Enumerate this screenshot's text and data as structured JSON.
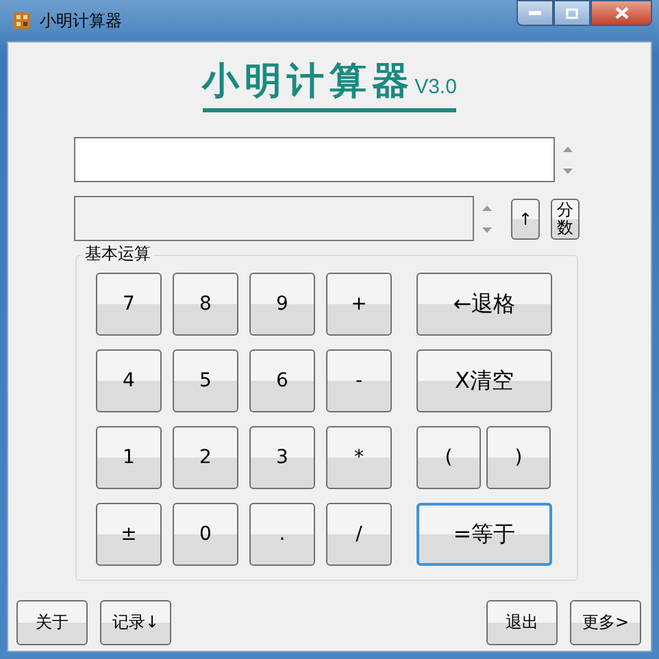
{
  "window": {
    "title": "小明计算器"
  },
  "heading": {
    "title": "小明计算器",
    "version": "V3.0"
  },
  "side_buttons": [
    {
      "label": "↑",
      "kind": "arrow"
    },
    {
      "label": "分数",
      "kind": "vertical"
    }
  ],
  "group": {
    "title": "基本运算",
    "rows": [
      [
        {
          "label": "7",
          "kind": "normal",
          "focused": false
        },
        {
          "label": "8",
          "kind": "normal",
          "focused": false
        },
        {
          "label": "9",
          "kind": "normal",
          "focused": false
        },
        {
          "label": "+",
          "kind": "normal",
          "focused": false
        },
        {
          "label": "←退格",
          "kind": "wide",
          "focused": false
        }
      ],
      [
        {
          "label": "4",
          "kind": "normal",
          "focused": false
        },
        {
          "label": "5",
          "kind": "normal",
          "focused": false
        },
        {
          "label": "6",
          "kind": "normal",
          "focused": false
        },
        {
          "label": "-",
          "kind": "normal",
          "focused": false
        },
        {
          "label": "X清空",
          "kind": "wide",
          "focused": false
        }
      ],
      [
        {
          "label": "1",
          "kind": "normal",
          "focused": false
        },
        {
          "label": "2",
          "kind": "normal",
          "focused": false
        },
        {
          "label": "3",
          "kind": "normal",
          "focused": false
        },
        {
          "label": "*",
          "kind": "normal",
          "focused": false
        },
        {
          "label": "(",
          "kind": "half",
          "focused": false
        },
        {
          "label": ")",
          "kind": "half",
          "focused": false
        }
      ],
      [
        {
          "label": "±",
          "kind": "normal",
          "focused": false
        },
        {
          "label": "0",
          "kind": "normal",
          "focused": false
        },
        {
          "label": ".",
          "kind": "normal",
          "focused": false
        },
        {
          "label": "/",
          "kind": "normal",
          "focused": false
        },
        {
          "label": "=等于",
          "kind": "wide",
          "focused": true
        }
      ]
    ]
  },
  "footer_left": [
    "关于",
    "记录↓"
  ],
  "footer_right": [
    "退出",
    "更多>"
  ]
}
